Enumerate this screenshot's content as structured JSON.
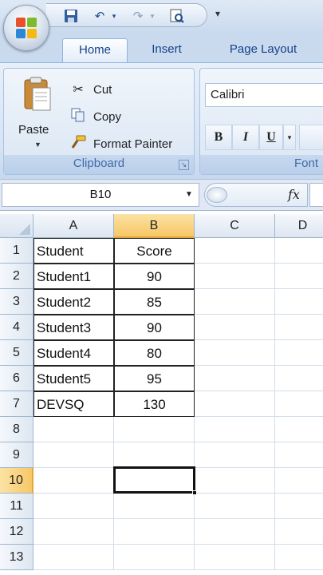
{
  "ribbon": {
    "tabs": [
      {
        "label": "Home",
        "active": true
      },
      {
        "label": "Insert",
        "active": false
      },
      {
        "label": "Page Layout",
        "active": false
      }
    ],
    "clipboard": {
      "paste_label": "Paste",
      "cut_label": "Cut",
      "copy_label": "Copy",
      "format_painter_label": "Format Painter",
      "group_label": "Clipboard"
    },
    "font": {
      "font_name": "Calibri",
      "bold_label": "B",
      "italic_label": "I",
      "underline_label": "U",
      "group_label": "Font"
    }
  },
  "formula_bar": {
    "name_box": "B10",
    "fx_label": "fx",
    "formula": ""
  },
  "sheet": {
    "columns": [
      "A",
      "B",
      "C",
      "D"
    ],
    "selected_column": "B",
    "rows": [
      {
        "num": "1",
        "a": "Student",
        "b": "Score"
      },
      {
        "num": "2",
        "a": "Student1",
        "b": "90"
      },
      {
        "num": "3",
        "a": "Student2",
        "b": "85"
      },
      {
        "num": "4",
        "a": "Student3",
        "b": "90"
      },
      {
        "num": "5",
        "a": "Student4",
        "b": "80"
      },
      {
        "num": "6",
        "a": "Student5",
        "b": "95"
      },
      {
        "num": "7",
        "a": "DEVSQ",
        "b": "130"
      },
      {
        "num": "8",
        "a": "",
        "b": ""
      },
      {
        "num": "9",
        "a": "",
        "b": ""
      },
      {
        "num": "10",
        "a": "",
        "b": ""
      },
      {
        "num": "11",
        "a": "",
        "b": ""
      },
      {
        "num": "12",
        "a": "",
        "b": ""
      },
      {
        "num": "13",
        "a": "",
        "b": ""
      }
    ],
    "selected_row": "10",
    "active_cell": "B10"
  },
  "icons": {
    "office_button": "office-logo-icon",
    "save": "save-icon",
    "undo": "undo-icon",
    "redo": "redo-icon",
    "print_preview": "print-preview-icon",
    "paste": "clipboard-paste-icon",
    "cut": "scissors-icon",
    "copy": "copy-icon",
    "format_painter": "paintbrush-icon"
  },
  "colors": {
    "selected_header": "#f7c766",
    "ribbon_text": "#15428b",
    "grid_line": "#d4dde8"
  }
}
